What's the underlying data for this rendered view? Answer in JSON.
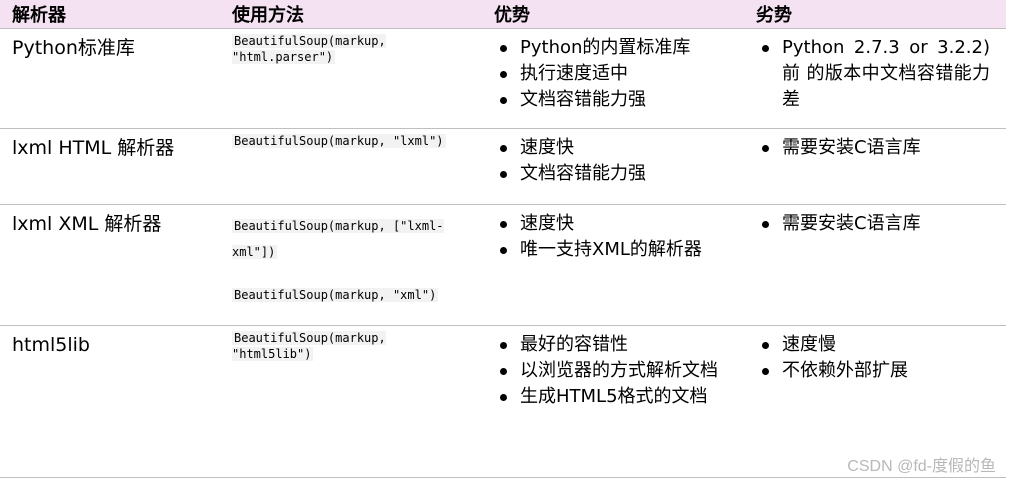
{
  "headers": {
    "parser": "解析器",
    "usage": "使用方法",
    "pros": "优势",
    "cons": "劣势"
  },
  "rows": [
    {
      "name": "Python标准库",
      "usage": [
        "BeautifulSoup(markup, \"html.parser\")"
      ],
      "pros": [
        "Python的内置标准库",
        "执行速度适中",
        "文档容错能力强"
      ],
      "cons": [
        "Python 2.7.3 or 3.2.2)前 的版本中文档容错能力差"
      ]
    },
    {
      "name": "lxml HTML 解析器",
      "usage": [
        "BeautifulSoup(markup, \"lxml\")"
      ],
      "pros": [
        "速度快",
        "文档容错能力强"
      ],
      "cons": [
        "需要安装C语言库"
      ]
    },
    {
      "name": "lxml XML 解析器",
      "usage": [
        "BeautifulSoup(markup, [\"lxml-xml\"])",
        "BeautifulSoup(markup, \"xml\")"
      ],
      "pros": [
        "速度快",
        "唯一支持XML的解析器"
      ],
      "cons": [
        "需要安装C语言库"
      ]
    },
    {
      "name": "html5lib",
      "usage": [
        "BeautifulSoup(markup, \"html5lib\")"
      ],
      "pros": [
        "最好的容错性",
        "以浏览器的方式解析文档",
        "生成HTML5格式的文档"
      ],
      "cons": [
        "速度慢",
        "不依赖外部扩展"
      ]
    }
  ],
  "watermark": "CSDN @fd-度假的鱼",
  "colors": {
    "header_bg": "#f4e2f3",
    "row_border": "#bfbfbf",
    "watermark": "#b8b8b8"
  }
}
